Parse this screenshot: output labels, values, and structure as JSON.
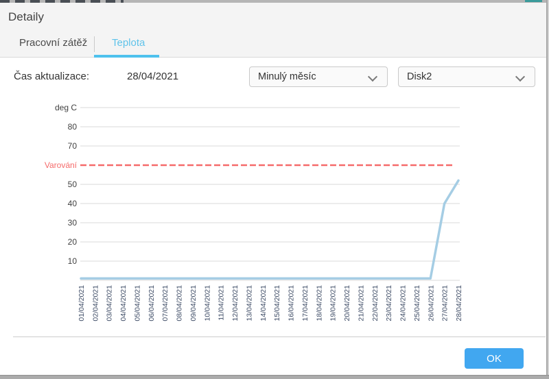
{
  "window": {
    "top_strip_color": "#b5b5b5",
    "top_accent": {
      "color": "#3a9b9b",
      "left": 765,
      "width": 25
    },
    "right_border_color": "#a6a6a6",
    "bottom_strip_color": "#ababab"
  },
  "dialog": {
    "title": "Detaily",
    "tabs": [
      {
        "label": "Pracovní zátěž",
        "active": false
      },
      {
        "label": "Teplota",
        "active": true
      }
    ],
    "active_tab_color": "#5fc3ea",
    "active_underline_color": "#4ec1ed"
  },
  "controls": {
    "update_time_label": "Čas aktualizace:",
    "update_time_value": "28/04/2021",
    "period_select_value": "Minulý měsíc",
    "disk_select_value": "Disk2"
  },
  "footer": {
    "ok_label": "OK",
    "ok_color": "#41a7f0"
  },
  "chart_data": {
    "type": "line",
    "unit_label": "deg C",
    "ylim": [
      0,
      90
    ],
    "y_ticks": [
      80,
      70,
      50,
      40,
      30,
      20,
      10
    ],
    "warning": {
      "label": "Varování",
      "value": 60,
      "color": "#f56a6a"
    },
    "x": [
      "01/04/2021",
      "02/04/2021",
      "03/04/2021",
      "04/04/2021",
      "05/04/2021",
      "06/04/2021",
      "07/04/2021",
      "08/04/2021",
      "09/04/2021",
      "10/04/2021",
      "11/04/2021",
      "12/04/2021",
      "13/04/2021",
      "14/04/2021",
      "15/04/2021",
      "16/04/2021",
      "17/04/2021",
      "18/04/2021",
      "19/04/2021",
      "20/04/2021",
      "21/04/2021",
      "22/04/2021",
      "23/04/2021",
      "24/04/2021",
      "25/04/2021",
      "26/04/2021",
      "27/04/2021",
      "28/04/2021"
    ],
    "values": [
      1,
      1,
      1,
      1,
      1,
      1,
      1,
      1,
      1,
      1,
      1,
      1,
      1,
      1,
      1,
      1,
      1,
      1,
      1,
      1,
      1,
      1,
      1,
      1,
      1,
      1,
      40,
      52
    ],
    "line_color": "#a5cde4",
    "grid_color": "#d9d9d9",
    "axis_label_color": "#3f3f3f",
    "x_label_color": "#3e4c66",
    "grid": true,
    "legend": "none"
  }
}
